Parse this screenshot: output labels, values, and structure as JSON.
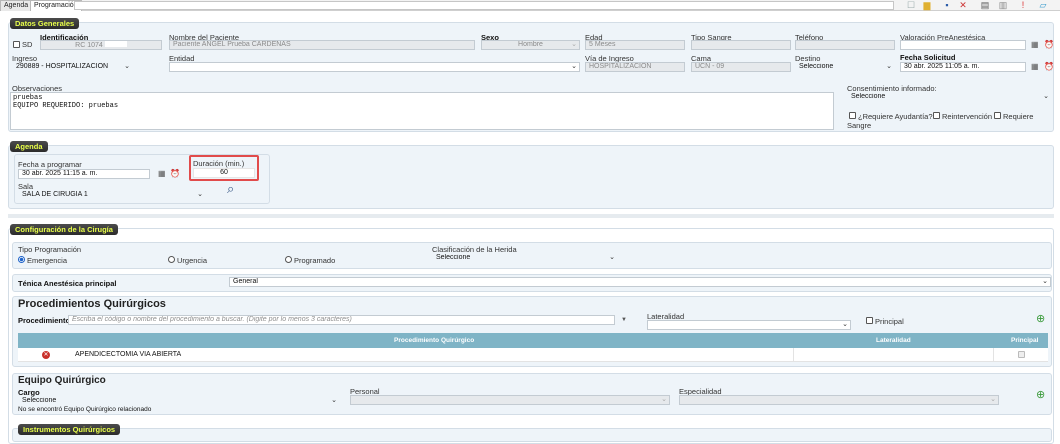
{
  "tabs": [
    {
      "label": "Agenda",
      "active": false
    },
    {
      "label": "Programación",
      "active": true
    }
  ],
  "datos_generales": {
    "title": "Datos Generales",
    "sd_label": "SD",
    "identificacion": {
      "label": "Identificación",
      "value": "RC 1074"
    },
    "nombre": {
      "label": "Nombre del Paciente",
      "value": "Paciente ANGEL Prueba CARDENAS"
    },
    "sexo": {
      "label": "Sexo",
      "value": "Hombre"
    },
    "edad": {
      "label": "Edad",
      "value": "5 Meses"
    },
    "tipo_sangre": {
      "label": "Tipo Sangre",
      "value": ""
    },
    "telefono": {
      "label": "Teléfono",
      "value": ""
    },
    "valoracion": {
      "label": "Valoración PreAnestésica",
      "value": ""
    },
    "ingreso": {
      "label": "Ingreso",
      "value": "290889 - HOSPITALIZACION"
    },
    "entidad": {
      "label": "Entidad",
      "value": ""
    },
    "via_ingreso": {
      "label": "Vía de Ingreso",
      "value": "HOSPITALIZACION"
    },
    "cama": {
      "label": "Cama",
      "value": "UCN - 09"
    },
    "destino": {
      "label": "Destino",
      "value": "Seleccione"
    },
    "fecha_solicitud": {
      "label": "Fecha Solicitud",
      "value": "30 abr. 2025 11:05 a. m."
    },
    "observaciones": {
      "label": "Observaciones",
      "value": "pruebas\nEQUIPO REQUERIDO: pruebas"
    },
    "consentimiento": {
      "label": "Consentimiento informado:",
      "value": "Seleccione"
    },
    "requiere_ayudantia": "¿Requiere Ayudantía?",
    "reintervencion": "Reintervención",
    "requiere_sangre_1": "Requiere",
    "requiere_sangre_2": "Sangre"
  },
  "agenda": {
    "title": "Agenda",
    "fecha": {
      "label": "Fecha a programar",
      "value": "30 abr. 2025 11:15 a. m."
    },
    "duracion": {
      "label": "Duración (min.)",
      "value": "60"
    },
    "sala": {
      "label": "Sala",
      "value": "SALA DE CIRUGÍA 1"
    }
  },
  "configuracion": {
    "title": "Configuración de la Cirugía",
    "tipo_programacion": {
      "label": "Tipo Programación",
      "options": [
        "Emergencia",
        "Urgencia",
        "Programado"
      ],
      "selected": "Emergencia"
    },
    "clasificacion_herida": {
      "label": "Clasificación de la Herida",
      "value": "Seleccione"
    },
    "tecnica": {
      "label": "Ténica Anestésica principal",
      "value": "General"
    }
  },
  "procedimientos": {
    "title": "Procedimientos Quirúrgicos",
    "procedimiento_label": "Procedimiento",
    "procedimiento_placeholder": "Escriba el código o nombre del procedimiento a buscar. (Digite por lo menos 3 caracteres)",
    "lateralidad_label": "Lateralidad",
    "lateralidad_value": "",
    "principal_label": "Principal",
    "columns": [
      "Procedimiento Quirúrgico",
      "Lateralidad",
      "Principal"
    ],
    "rows": [
      {
        "procedimiento": "APENDICECTOMIA VIA ABIERTA",
        "lateralidad": "",
        "principal": false
      }
    ]
  },
  "equipo": {
    "title": "Equipo Quirúrgico",
    "cargo": {
      "label": "Cargo",
      "value": "Seleccione"
    },
    "personal": {
      "label": "Personal",
      "value": ""
    },
    "especialidad": {
      "label": "Especialidad",
      "value": ""
    },
    "empty_message": "No se encontró Equipo Quirúrgico relacionado"
  },
  "instrumentos": {
    "title": "Instrumentos Quirúrgicos"
  },
  "colors": {
    "section_title_bg": "#333333",
    "section_title_fg": "#e9ff4a",
    "panel_bg": "#eef4f9",
    "table_header": "#7fb4c6",
    "highlight": "#e14b4b"
  }
}
